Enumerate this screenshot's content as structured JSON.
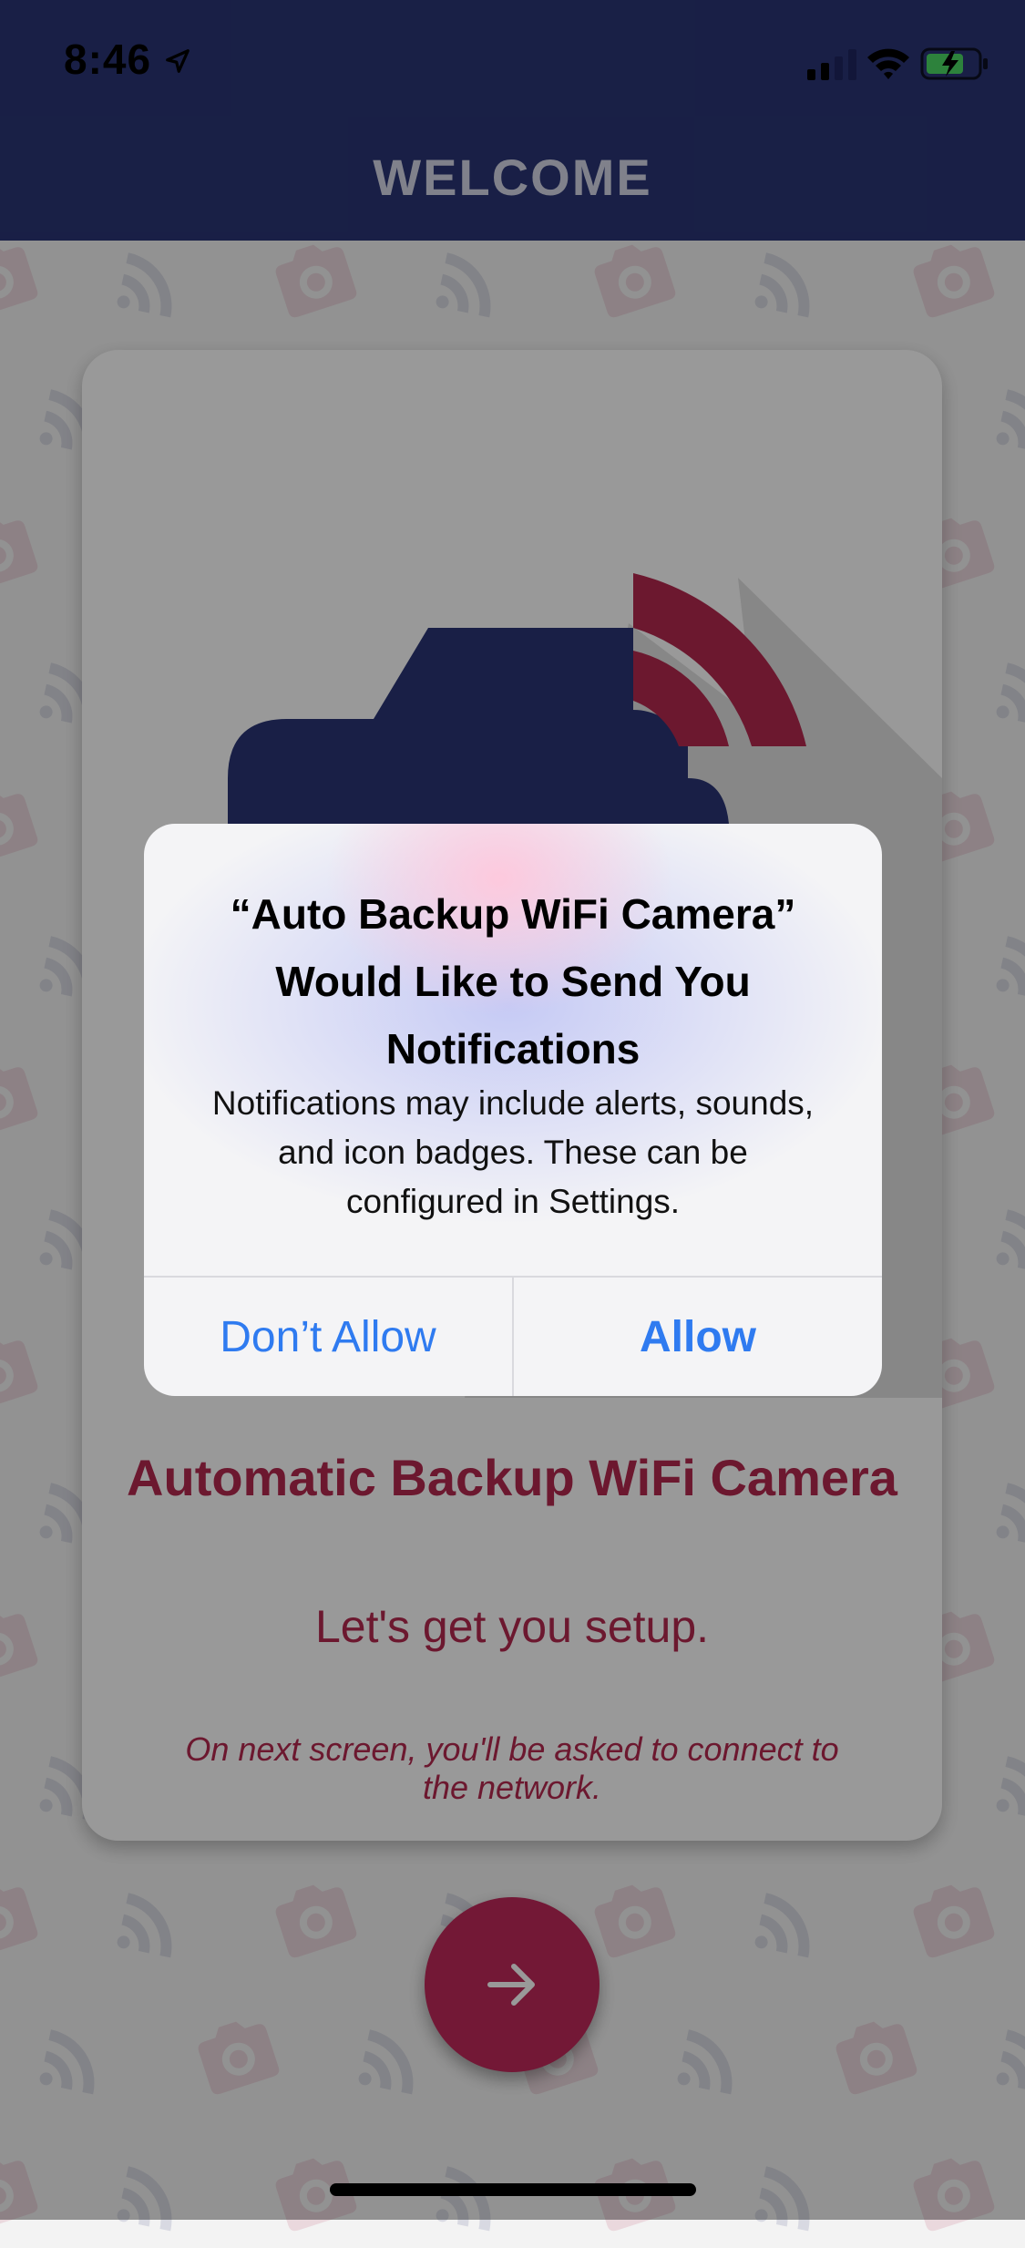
{
  "status_bar": {
    "time": "8:46",
    "icons": [
      "location-arrow-icon",
      "cellular-signal-icon",
      "wifi-icon",
      "battery-charging-icon"
    ]
  },
  "header": {
    "title": "WELCOME"
  },
  "card": {
    "title": "Automatic Backup WiFi Camera",
    "subtitle": "Let's get you setup.",
    "note": "On next screen, you'll be asked to connect to the network."
  },
  "next_button": {
    "icon": "arrow-right-icon"
  },
  "alert": {
    "title": "“Auto Backup WiFi Camera” Would Like to Send You Notifications",
    "message": "Notifications may include alerts, sounds, and icon badges. These can be configured in Settings.",
    "buttons": [
      {
        "label": "Don’t Allow"
      },
      {
        "label": "Allow"
      }
    ]
  },
  "colors": {
    "header": "#2a3575",
    "brand_red": "#b4284f",
    "button_red": "#c0285b",
    "camera_blue": "#2a3575",
    "alert_button_text": "#2f7bf0"
  }
}
